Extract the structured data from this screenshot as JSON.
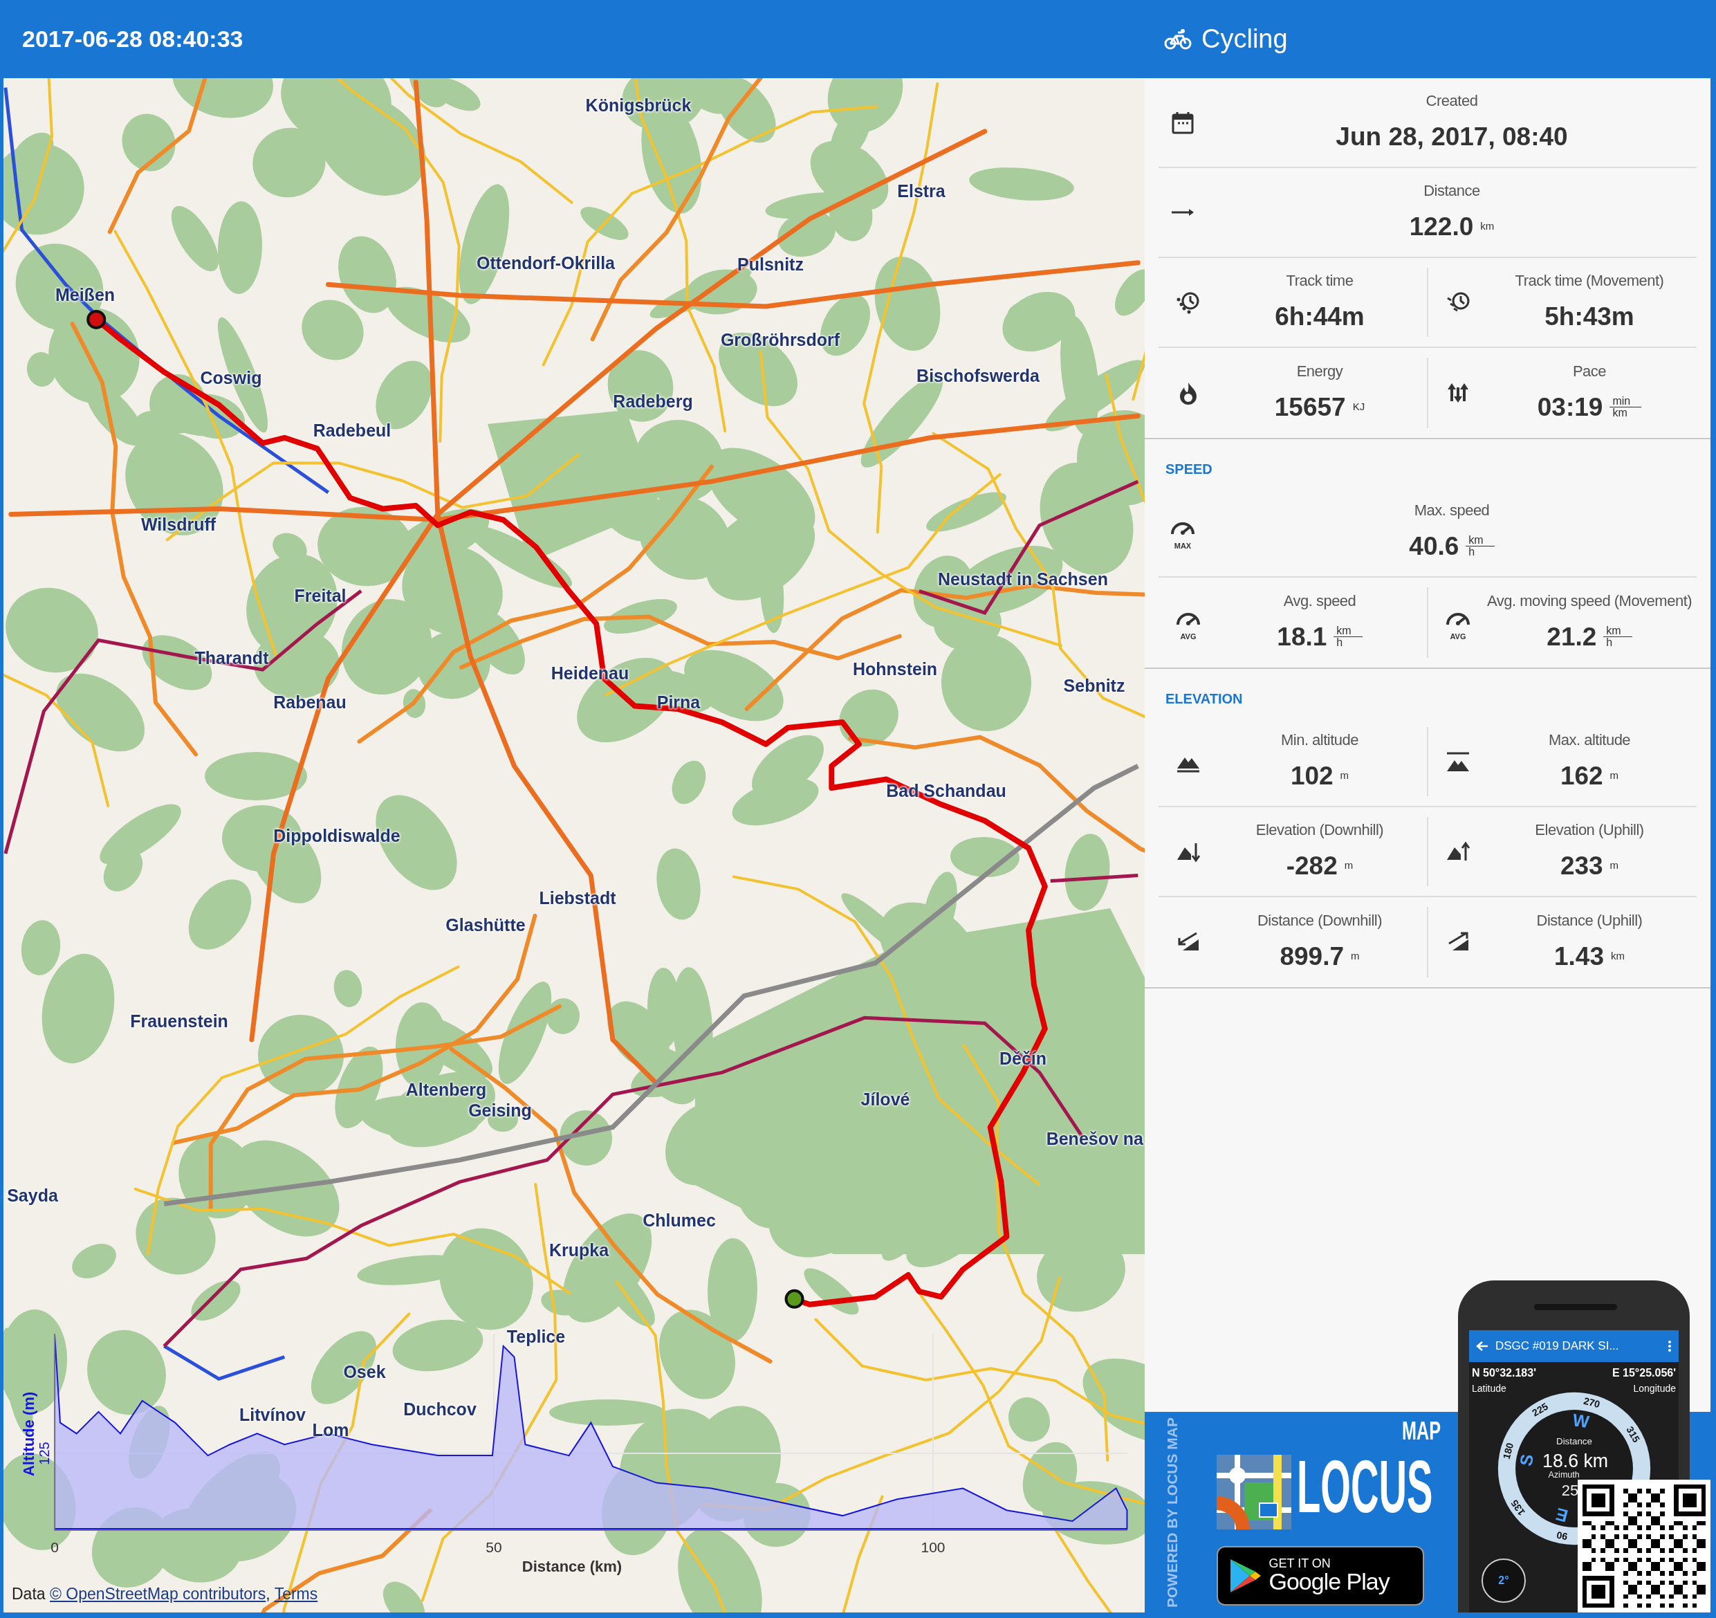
{
  "header": {
    "timestamp": "2017-06-28 08:40:33",
    "activity": "Cycling"
  },
  "map": {
    "places": [
      "Königsbrück",
      "Elstra",
      "Ottendorf-Okrilla",
      "Pulsnitz",
      "Meißen",
      "Coswig",
      "Großröhrsdorf",
      "Radeberg",
      "Bischofswerda",
      "Radebeul",
      "Wilsdruff",
      "Neustadt in Sachsen",
      "Freital",
      "Tharandt",
      "Heidenau",
      "Pirna",
      "Hohnstein",
      "Sebnitz",
      "Rabenau",
      "Bad Schandau",
      "Dippoldiswalde",
      "Liebstadt",
      "Glashütte",
      "Frauenstein",
      "Děčín",
      "Jílové",
      "Altenberg",
      "Geising",
      "Benešov na",
      "Sayda",
      "Chlumec",
      "Krupka",
      "Teplice",
      "Osek",
      "Duchcov",
      "Litvínov",
      "Lom"
    ],
    "elevation_chart": {
      "ylabel": "Altitude (m)",
      "ytick": "125",
      "xticks": [
        "0",
        "50",
        "100"
      ],
      "xlabel": "Distance (km)"
    },
    "attribution": {
      "prefix": "Data ",
      "links": [
        "© OpenStreetMap contributors",
        "Terms"
      ],
      "separator": ", "
    }
  },
  "stats": {
    "sections": [
      {
        "rows": [
          [
            {
              "label": "Created",
              "value": "Jun 28, 2017, 08:40"
            }
          ],
          [
            {
              "label": "Distance",
              "value": "122.0",
              "unit": "km"
            }
          ],
          [
            {
              "label": "Track time",
              "value": "6h:44m"
            },
            {
              "label": "Track time (Movement)",
              "value": "5h:43m"
            }
          ],
          [
            {
              "label": "Energy",
              "value": "15657",
              "unit": "KJ"
            },
            {
              "label": "Pace",
              "value": "03:19",
              "unit_top": "min",
              "unit_bottom": "km"
            }
          ]
        ]
      },
      {
        "heading": "SPEED",
        "rows": [
          [
            {
              "label": "Max. speed",
              "value": "40.6",
              "unit_top": "km",
              "unit_bottom": "h",
              "icon_text": "MAX"
            }
          ],
          [
            {
              "label": "Avg. speed",
              "value": "18.1",
              "unit_top": "km",
              "unit_bottom": "h",
              "icon_text": "AVG"
            },
            {
              "label": "Avg. moving speed (Movement)",
              "value": "21.2",
              "unit_top": "km",
              "unit_bottom": "h",
              "icon_text": "AVG"
            }
          ]
        ]
      },
      {
        "heading": "ELEVATION",
        "rows": [
          [
            {
              "label": "Min. altitude",
              "value": "102",
              "unit": "m"
            },
            {
              "label": "Max. altitude",
              "value": "162",
              "unit": "m"
            }
          ],
          [
            {
              "label": "Elevation (Downhill)",
              "value": "-282",
              "unit": "m"
            },
            {
              "label": "Elevation (Uphill)",
              "value": "233",
              "unit": "m"
            }
          ],
          [
            {
              "label": "Distance (Downhill)",
              "value": "899.7",
              "unit": "m"
            },
            {
              "label": "Distance (Uphill)",
              "value": "1.43",
              "unit": "km"
            }
          ]
        ]
      }
    ]
  },
  "ad": {
    "side_text": "POWERED BY LOCUS MAP",
    "logo_small": "MAP",
    "logo_big": "LOCUS",
    "badge_line1": "GET IT ON",
    "badge_line2": "Google Play",
    "phone": {
      "title": "DSGC #019 DARK SI...",
      "lat": "N 50°32.183'",
      "lat_label": "Latitude",
      "lon": "E 15°25.056'",
      "lon_label": "Longitude",
      "compass_ticks": [
        "270",
        "225",
        "315",
        "180",
        "135",
        "90"
      ],
      "compass_letters": [
        "W",
        "S",
        "E"
      ],
      "distance_label": "Distance",
      "distance": "18.6 km",
      "azimuth_label": "Azimuth",
      "azimuth": "25",
      "tilt": "2°"
    }
  }
}
